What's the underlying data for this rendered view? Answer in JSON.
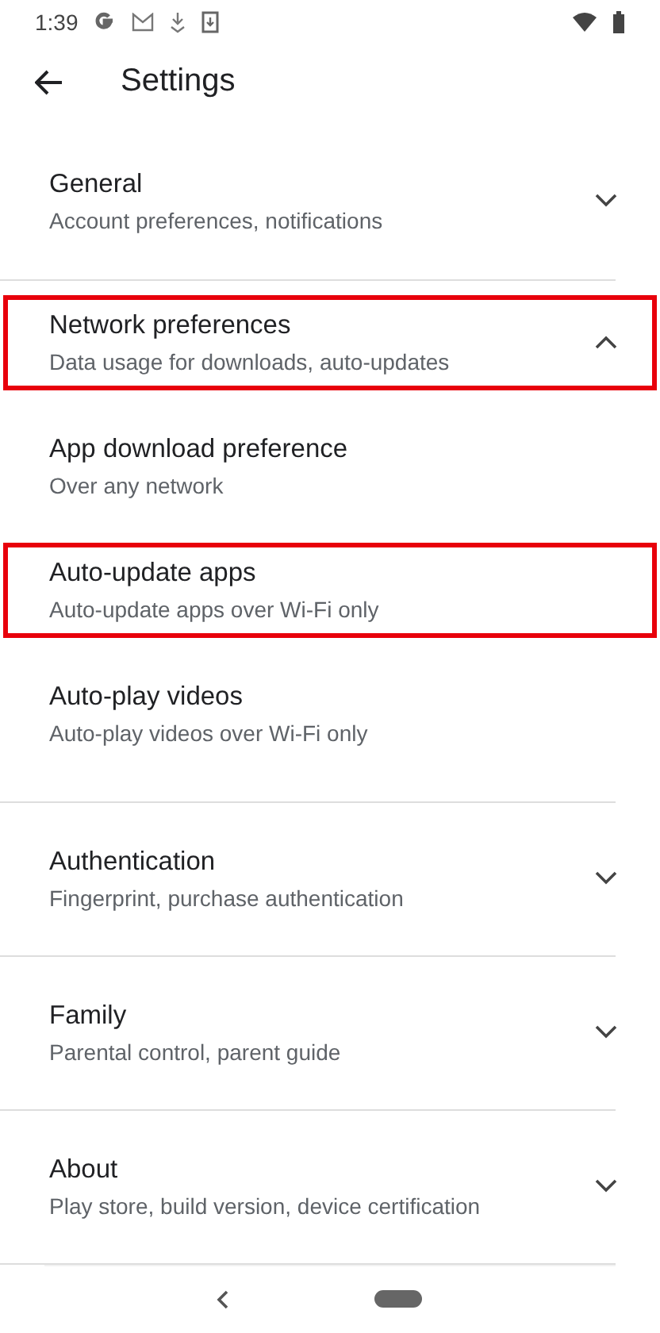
{
  "status_bar": {
    "time": "1:39"
  },
  "header": {
    "title": "Settings"
  },
  "sections": [
    {
      "title": "General",
      "subtitle": "Account preferences, notifications",
      "expanded": false,
      "highlighted": false
    },
    {
      "title": "Network preferences",
      "subtitle": "Data usage for downloads, auto-updates",
      "expanded": true,
      "highlighted": true,
      "children": [
        {
          "title": "App download preference",
          "subtitle": "Over any network",
          "highlighted": false
        },
        {
          "title": "Auto-update apps",
          "subtitle": "Auto-update apps over Wi-Fi only",
          "highlighted": true
        },
        {
          "title": "Auto-play videos",
          "subtitle": "Auto-play videos over Wi-Fi only",
          "highlighted": false
        }
      ]
    },
    {
      "title": "Authentication",
      "subtitle": "Fingerprint, purchase authentication",
      "expanded": false,
      "highlighted": false
    },
    {
      "title": "Family",
      "subtitle": "Parental control, parent guide",
      "expanded": false,
      "highlighted": false
    },
    {
      "title": "About",
      "subtitle": "Play store, build version, device certification",
      "expanded": false,
      "highlighted": false
    }
  ]
}
